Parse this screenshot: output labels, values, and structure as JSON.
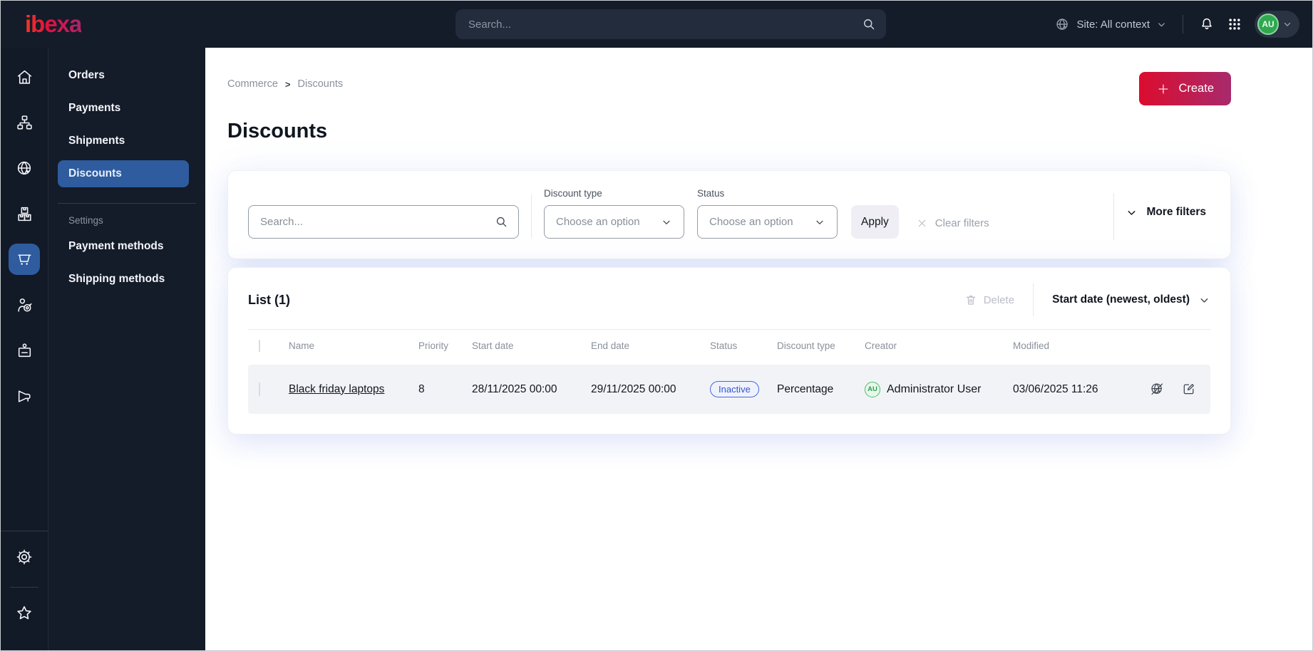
{
  "topbar": {
    "logo_text": "ibexa",
    "search_placeholder": "Search...",
    "site_label": "Site: All context",
    "avatar_initials": "AU"
  },
  "menu": {
    "items": [
      {
        "label": "Orders",
        "active": false
      },
      {
        "label": "Payments",
        "active": false
      },
      {
        "label": "Shipments",
        "active": false
      },
      {
        "label": "Discounts",
        "active": true
      }
    ],
    "section": "Settings",
    "section_items": [
      {
        "label": "Payment methods"
      },
      {
        "label": "Shipping methods"
      }
    ]
  },
  "breadcrumb": {
    "parent": "Commerce",
    "separator": ">",
    "current": "Discounts"
  },
  "page": {
    "title": "Discounts",
    "create_label": "Create"
  },
  "filters": {
    "search_placeholder": "Search...",
    "discount_type": {
      "label": "Discount type",
      "value": "Choose an option"
    },
    "status": {
      "label": "Status",
      "value": "Choose an option"
    },
    "apply_label": "Apply",
    "clear_label": "Clear filters",
    "more_label": "More filters"
  },
  "list": {
    "title": "List (1)",
    "delete_label": "Delete",
    "sort_label": "Start date (newest, oldest)",
    "columns": [
      "Name",
      "Priority",
      "Start date",
      "End date",
      "Status",
      "Discount type",
      "Creator",
      "Modified"
    ],
    "rows": [
      {
        "name": "Black friday laptops",
        "priority": "8",
        "start_date": "28/11/2025 00:00",
        "end_date": "29/11/2025 00:00",
        "status": "Inactive",
        "discount_type": "Percentage",
        "creator_initials": "AU",
        "creator_name": "Administrator User",
        "modified": "03/06/2025 11:26"
      }
    ]
  },
  "colors": {
    "topbar_bg": "#141b29",
    "active_blue": "#2e5c9e",
    "accent_gradient_start": "#dc0c2e",
    "accent_gradient_end": "#a82a6c",
    "status_inactive_text": "#3b52cc",
    "status_inactive_border": "#4b66dd",
    "status_inactive_bg": "#eef2fd",
    "avatar_green": "#2fa84f"
  }
}
